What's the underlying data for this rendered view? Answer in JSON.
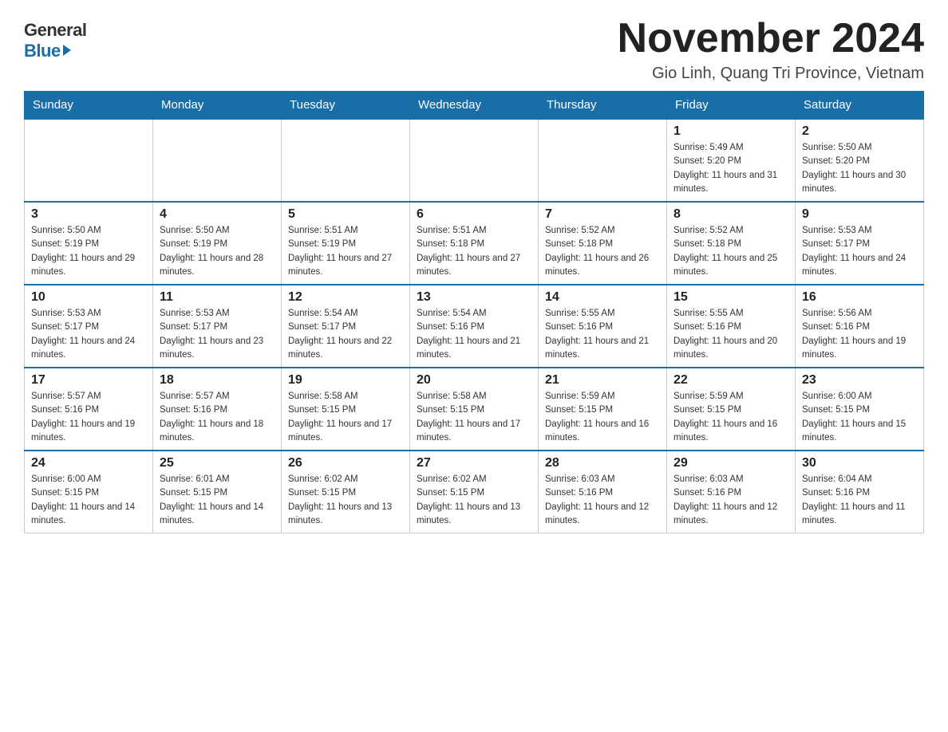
{
  "header": {
    "logo_general": "General",
    "logo_blue": "Blue",
    "title": "November 2024",
    "location": "Gio Linh, Quang Tri Province, Vietnam"
  },
  "weekdays": [
    "Sunday",
    "Monday",
    "Tuesday",
    "Wednesday",
    "Thursday",
    "Friday",
    "Saturday"
  ],
  "weeks": [
    [
      {
        "day": "",
        "info": ""
      },
      {
        "day": "",
        "info": ""
      },
      {
        "day": "",
        "info": ""
      },
      {
        "day": "",
        "info": ""
      },
      {
        "day": "",
        "info": ""
      },
      {
        "day": "1",
        "info": "Sunrise: 5:49 AM\nSunset: 5:20 PM\nDaylight: 11 hours and 31 minutes."
      },
      {
        "day": "2",
        "info": "Sunrise: 5:50 AM\nSunset: 5:20 PM\nDaylight: 11 hours and 30 minutes."
      }
    ],
    [
      {
        "day": "3",
        "info": "Sunrise: 5:50 AM\nSunset: 5:19 PM\nDaylight: 11 hours and 29 minutes."
      },
      {
        "day": "4",
        "info": "Sunrise: 5:50 AM\nSunset: 5:19 PM\nDaylight: 11 hours and 28 minutes."
      },
      {
        "day": "5",
        "info": "Sunrise: 5:51 AM\nSunset: 5:19 PM\nDaylight: 11 hours and 27 minutes."
      },
      {
        "day": "6",
        "info": "Sunrise: 5:51 AM\nSunset: 5:18 PM\nDaylight: 11 hours and 27 minutes."
      },
      {
        "day": "7",
        "info": "Sunrise: 5:52 AM\nSunset: 5:18 PM\nDaylight: 11 hours and 26 minutes."
      },
      {
        "day": "8",
        "info": "Sunrise: 5:52 AM\nSunset: 5:18 PM\nDaylight: 11 hours and 25 minutes."
      },
      {
        "day": "9",
        "info": "Sunrise: 5:53 AM\nSunset: 5:17 PM\nDaylight: 11 hours and 24 minutes."
      }
    ],
    [
      {
        "day": "10",
        "info": "Sunrise: 5:53 AM\nSunset: 5:17 PM\nDaylight: 11 hours and 24 minutes."
      },
      {
        "day": "11",
        "info": "Sunrise: 5:53 AM\nSunset: 5:17 PM\nDaylight: 11 hours and 23 minutes."
      },
      {
        "day": "12",
        "info": "Sunrise: 5:54 AM\nSunset: 5:17 PM\nDaylight: 11 hours and 22 minutes."
      },
      {
        "day": "13",
        "info": "Sunrise: 5:54 AM\nSunset: 5:16 PM\nDaylight: 11 hours and 21 minutes."
      },
      {
        "day": "14",
        "info": "Sunrise: 5:55 AM\nSunset: 5:16 PM\nDaylight: 11 hours and 21 minutes."
      },
      {
        "day": "15",
        "info": "Sunrise: 5:55 AM\nSunset: 5:16 PM\nDaylight: 11 hours and 20 minutes."
      },
      {
        "day": "16",
        "info": "Sunrise: 5:56 AM\nSunset: 5:16 PM\nDaylight: 11 hours and 19 minutes."
      }
    ],
    [
      {
        "day": "17",
        "info": "Sunrise: 5:57 AM\nSunset: 5:16 PM\nDaylight: 11 hours and 19 minutes."
      },
      {
        "day": "18",
        "info": "Sunrise: 5:57 AM\nSunset: 5:16 PM\nDaylight: 11 hours and 18 minutes."
      },
      {
        "day": "19",
        "info": "Sunrise: 5:58 AM\nSunset: 5:15 PM\nDaylight: 11 hours and 17 minutes."
      },
      {
        "day": "20",
        "info": "Sunrise: 5:58 AM\nSunset: 5:15 PM\nDaylight: 11 hours and 17 minutes."
      },
      {
        "day": "21",
        "info": "Sunrise: 5:59 AM\nSunset: 5:15 PM\nDaylight: 11 hours and 16 minutes."
      },
      {
        "day": "22",
        "info": "Sunrise: 5:59 AM\nSunset: 5:15 PM\nDaylight: 11 hours and 16 minutes."
      },
      {
        "day": "23",
        "info": "Sunrise: 6:00 AM\nSunset: 5:15 PM\nDaylight: 11 hours and 15 minutes."
      }
    ],
    [
      {
        "day": "24",
        "info": "Sunrise: 6:00 AM\nSunset: 5:15 PM\nDaylight: 11 hours and 14 minutes."
      },
      {
        "day": "25",
        "info": "Sunrise: 6:01 AM\nSunset: 5:15 PM\nDaylight: 11 hours and 14 minutes."
      },
      {
        "day": "26",
        "info": "Sunrise: 6:02 AM\nSunset: 5:15 PM\nDaylight: 11 hours and 13 minutes."
      },
      {
        "day": "27",
        "info": "Sunrise: 6:02 AM\nSunset: 5:15 PM\nDaylight: 11 hours and 13 minutes."
      },
      {
        "day": "28",
        "info": "Sunrise: 6:03 AM\nSunset: 5:16 PM\nDaylight: 11 hours and 12 minutes."
      },
      {
        "day": "29",
        "info": "Sunrise: 6:03 AM\nSunset: 5:16 PM\nDaylight: 11 hours and 12 minutes."
      },
      {
        "day": "30",
        "info": "Sunrise: 6:04 AM\nSunset: 5:16 PM\nDaylight: 11 hours and 11 minutes."
      }
    ]
  ]
}
